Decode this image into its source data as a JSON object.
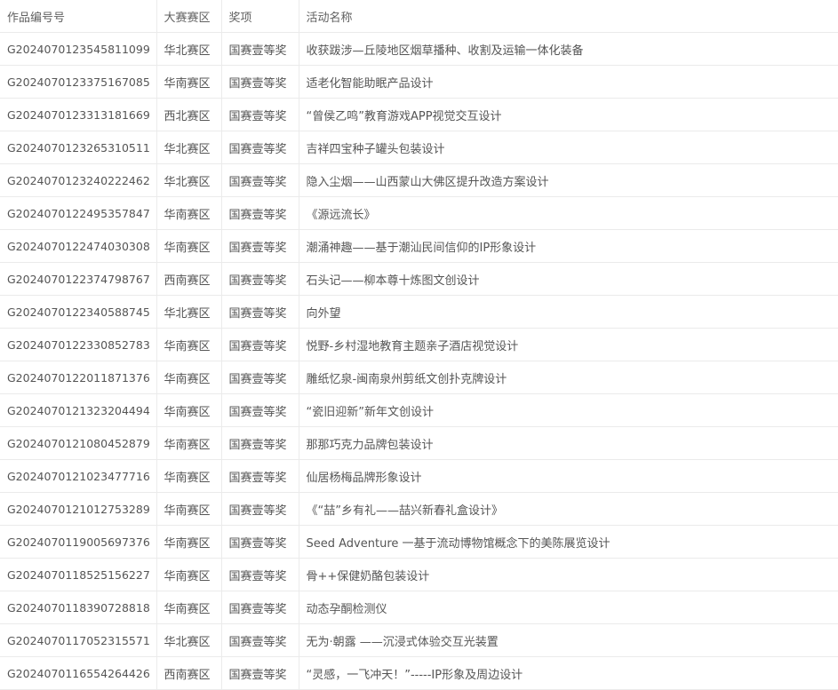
{
  "table": {
    "headers": {
      "id": "作品编号号",
      "region": "大赛赛区",
      "award": "奖项",
      "name": "活动名称"
    },
    "rows": [
      {
        "id": "G2024070123545811099",
        "region": "华北赛区",
        "award": "国赛壹等奖",
        "name": "收获跋涉—丘陵地区烟草播种、收割及运输一体化装备"
      },
      {
        "id": "G2024070123375167085",
        "region": "华南赛区",
        "award": "国赛壹等奖",
        "name": "适老化智能助眠产品设计"
      },
      {
        "id": "G2024070123313181669",
        "region": "西北赛区",
        "award": "国赛壹等奖",
        "name": "“曾侯乙鸣”教育游戏APP视觉交互设计"
      },
      {
        "id": "G2024070123265310511",
        "region": "华北赛区",
        "award": "国赛壹等奖",
        "name": "吉祥四宝种子罐头包装设计"
      },
      {
        "id": "G2024070123240222462",
        "region": "华北赛区",
        "award": "国赛壹等奖",
        "name": "隐入尘烟——山西蒙山大佛区提升改造方案设计"
      },
      {
        "id": "G2024070122495357847",
        "region": "华南赛区",
        "award": "国赛壹等奖",
        "name": "《源远流长》"
      },
      {
        "id": "G2024070122474030308",
        "region": "华南赛区",
        "award": "国赛壹等奖",
        "name": "潮涌神趣——基于潮汕民间信仰的IP形象设计"
      },
      {
        "id": "G2024070122374798767",
        "region": "西南赛区",
        "award": "国赛壹等奖",
        "name": "石头记——柳本尊十炼图文创设计"
      },
      {
        "id": "G2024070122340588745",
        "region": "华北赛区",
        "award": "国赛壹等奖",
        "name": "向外望"
      },
      {
        "id": "G2024070122330852783",
        "region": "华南赛区",
        "award": "国赛壹等奖",
        "name": "悦野-乡村湿地教育主题亲子酒店视觉设计"
      },
      {
        "id": "G2024070122011871376",
        "region": "华南赛区",
        "award": "国赛壹等奖",
        "name": "雕纸忆泉-闽南泉州剪纸文创扑克牌设计"
      },
      {
        "id": "G2024070121323204494",
        "region": "华南赛区",
        "award": "国赛壹等奖",
        "name": "“瓷旧迎新”新年文创设计"
      },
      {
        "id": "G2024070121080452879",
        "region": "华南赛区",
        "award": "国赛壹等奖",
        "name": "那那巧克力品牌包装设计"
      },
      {
        "id": "G2024070121023477716",
        "region": "华南赛区",
        "award": "国赛壹等奖",
        "name": "仙居杨梅品牌形象设计"
      },
      {
        "id": "G2024070121012753289",
        "region": "华南赛区",
        "award": "国赛壹等奖",
        "name": "《“喆”乡有礼——喆兴新春礼盒设计》"
      },
      {
        "id": "G2024070119005697376",
        "region": "华南赛区",
        "award": "国赛壹等奖",
        "name": "Seed Adventure 一基于流动博物馆概念下的美陈展览设计"
      },
      {
        "id": "G2024070118525156227",
        "region": "华南赛区",
        "award": "国赛壹等奖",
        "name": "骨++保健奶酪包装设计"
      },
      {
        "id": "G2024070118390728818",
        "region": "华南赛区",
        "award": "国赛壹等奖",
        "name": "动态孕酮检测仪"
      },
      {
        "id": "G2024070117052315571",
        "region": "华北赛区",
        "award": "国赛壹等奖",
        "name": "无为·朝露 ——沉浸式体验交互光装置"
      },
      {
        "id": "G2024070116554264426",
        "region": "西南赛区",
        "award": "国赛壹等奖",
        "name": "“灵感，一飞冲天！”-----IP形象及周边设计"
      }
    ]
  }
}
